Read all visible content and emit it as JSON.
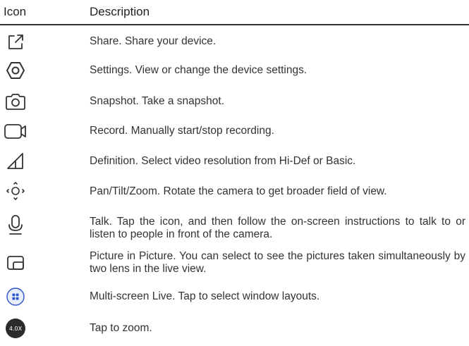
{
  "header": {
    "icon_col": "Icon",
    "desc_col": "Description"
  },
  "rows": [
    {
      "icon": "share-icon",
      "text": "Share. Share your device."
    },
    {
      "icon": "settings-icon",
      "text": "Settings. View or change the device settings."
    },
    {
      "icon": "camera-icon",
      "text": "Snapshot. Take a snapshot."
    },
    {
      "icon": "video-camera-icon",
      "text": "Record. Manually start/stop recording."
    },
    {
      "icon": "definition-icon",
      "text": "Definition. Select video resolution from Hi-Def or Basic."
    },
    {
      "icon": "pan-tilt-zoom-icon",
      "text": "Pan/Tilt/Zoom. Rotate the camera to get broader field of view."
    },
    {
      "icon": "microphone-icon",
      "text": "Talk. Tap the icon, and then follow the on-screen instructions to talk to or listen to people in front of the camera."
    },
    {
      "icon": "picture-in-picture-icon",
      "text": "Picture in Picture. You can select to see the pictures taken simultaneously by two lens in the live view."
    },
    {
      "icon": "multi-screen-icon",
      "text": "Multi-screen Live. Tap to select window layouts."
    },
    {
      "icon": "zoom-badge-icon",
      "badge": "4.0X",
      "text": "Tap to zoom."
    }
  ],
  "colors": {
    "icon_stroke": "#333333",
    "multi_screen_accent": "#2d55c8",
    "multi_screen_bg": "#e8eefb",
    "zoom_badge_bg": "#2b2b2b"
  }
}
